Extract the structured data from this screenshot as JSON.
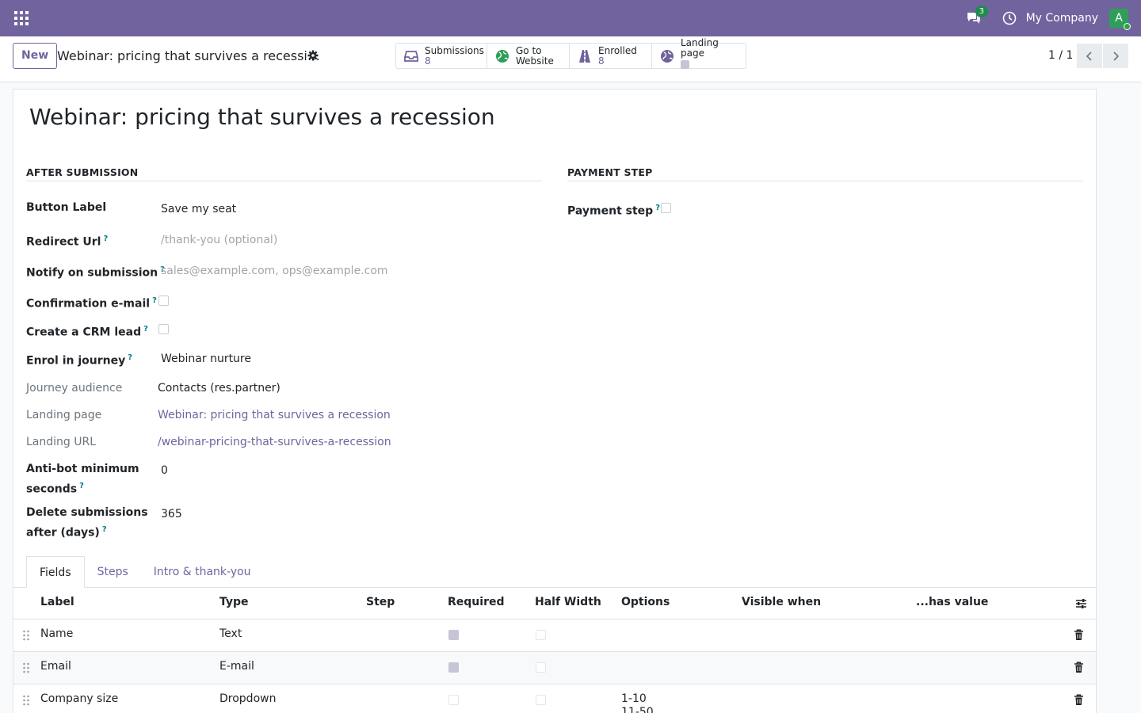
{
  "navbar": {
    "apps_icon": "apps-grid-icon",
    "chat_icon": "chat-bubbles-icon",
    "chat_badge": "3",
    "clock_icon": "clock-icon",
    "company": "My Company",
    "avatar_letter": "A",
    "brand_color": "#71639e"
  },
  "control": {
    "new_label": "New",
    "record_title": "Webinar: pricing that survives a recessi…",
    "smart_buttons": {
      "submissions": {
        "label": "Submissions",
        "value": "8",
        "icon": "inbox-icon"
      },
      "website": {
        "label1": "Go to",
        "label2": "Website",
        "icon": "globe-icon"
      },
      "enrolled": {
        "label": "Enrolled",
        "value": "8",
        "icon": "road-icon"
      },
      "landing": {
        "label": "Landing page",
        "checked": true,
        "icon": "globe-icon"
      }
    },
    "pager": "1 / 1"
  },
  "form": {
    "title": "Webinar: pricing that survives a recession",
    "after_submission": {
      "heading": "AFTER SUBMISSION",
      "button_label": {
        "label": "Button Label",
        "value": "Save my seat"
      },
      "redirect_url": {
        "label": "Redirect Url",
        "placeholder": "/thank-you (optional)"
      },
      "notify": {
        "label": "Notify on submission",
        "placeholder": "sales@example.com, ops@example.com"
      },
      "confirmation": {
        "label": "Confirmation e-mail",
        "checked": false
      },
      "crm_lead": {
        "label": "Create a CRM lead",
        "checked": false
      },
      "journey": {
        "label": "Enrol in journey",
        "value": "Webinar nurture"
      },
      "journey_audience": {
        "label": "Journey audience",
        "value": "Contacts (res.partner)"
      },
      "landing_page": {
        "label": "Landing page",
        "value": "Webinar: pricing that survives a recession"
      },
      "landing_url": {
        "label": "Landing URL",
        "value": "/webinar-pricing-that-survives-a-recession"
      },
      "antibot": {
        "label1": "Anti-bot minimum",
        "label2": "seconds",
        "value": "0"
      },
      "delete_after": {
        "label1": "Delete submissions",
        "label2": "after (days)",
        "value": "365"
      }
    },
    "payment": {
      "heading": "PAYMENT STEP",
      "payment_step": {
        "label": "Payment step",
        "checked": false
      }
    },
    "help_mark": "?"
  },
  "tabs": [
    "Fields",
    "Steps",
    "Intro & thank-you"
  ],
  "table": {
    "columns": [
      "Label",
      "Type",
      "Step",
      "Required",
      "Half Width",
      "Options",
      "Visible when",
      "...has value"
    ],
    "rows": [
      {
        "label": "Name",
        "type": "Text",
        "step": "",
        "required": true,
        "half_width": false,
        "options": "",
        "visible_when": "",
        "has_value": ""
      },
      {
        "label": "Email",
        "type": "E-mail",
        "step": "",
        "required": true,
        "half_width": false,
        "options": "",
        "visible_when": "",
        "has_value": ""
      },
      {
        "label": "Company size",
        "type": "Dropdown",
        "step": "",
        "required": false,
        "half_width": false,
        "options": "1-10",
        "options_next": "11-50",
        "visible_when": "",
        "has_value": ""
      }
    ]
  }
}
